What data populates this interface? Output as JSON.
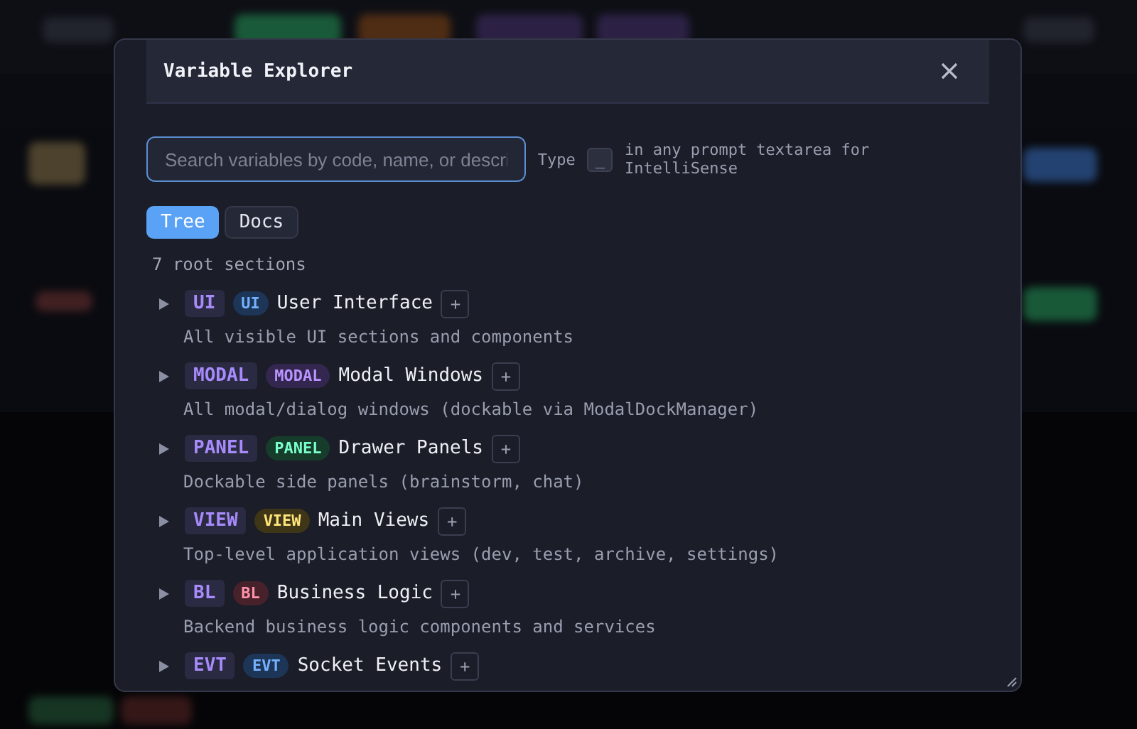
{
  "dialog": {
    "title": "Variable Explorer"
  },
  "search": {
    "placeholder": "Search variables by code, name, or descri"
  },
  "hint": {
    "before": "Type",
    "key": "_",
    "after": "in any prompt textarea for IntelliSense"
  },
  "tabs": [
    {
      "label": "Tree",
      "selected": true
    },
    {
      "label": "Docs",
      "selected": false
    }
  ],
  "summary": "7 root sections",
  "sections": [
    {
      "code": "UI",
      "tag": "UI",
      "color": "#1d3557",
      "name": "User Interface",
      "add": "+",
      "description": "All visible UI sections and components",
      "expanded": false
    },
    {
      "code": "MODAL",
      "tag": "MODAL",
      "color": "#33264f",
      "name": "Modal Windows",
      "add": "+",
      "description": "All modal/dialog windows (dockable via ModalDockManager)",
      "expanded": false
    },
    {
      "code": "PANEL",
      "tag": "PANEL",
      "color": "#163d2c",
      "name": "Drawer Panels",
      "add": "+",
      "description": "Dockable side panels (brainstorm, chat)",
      "expanded": false
    },
    {
      "code": "VIEW",
      "tag": "VIEW",
      "color": "#3f3517",
      "name": "Main Views",
      "add": "+",
      "description": "Top-level application views (dev, test, archive, settings)",
      "expanded": false
    },
    {
      "code": "BL",
      "tag": "BL",
      "color": "#48222a",
      "name": "Business Logic",
      "add": "+",
      "description": "Backend business logic components and services",
      "expanded": false
    },
    {
      "code": "EVT",
      "tag": "EVT",
      "color": "#1d3557",
      "name": "Socket Events",
      "add": "+",
      "expanded": false
    }
  ]
}
